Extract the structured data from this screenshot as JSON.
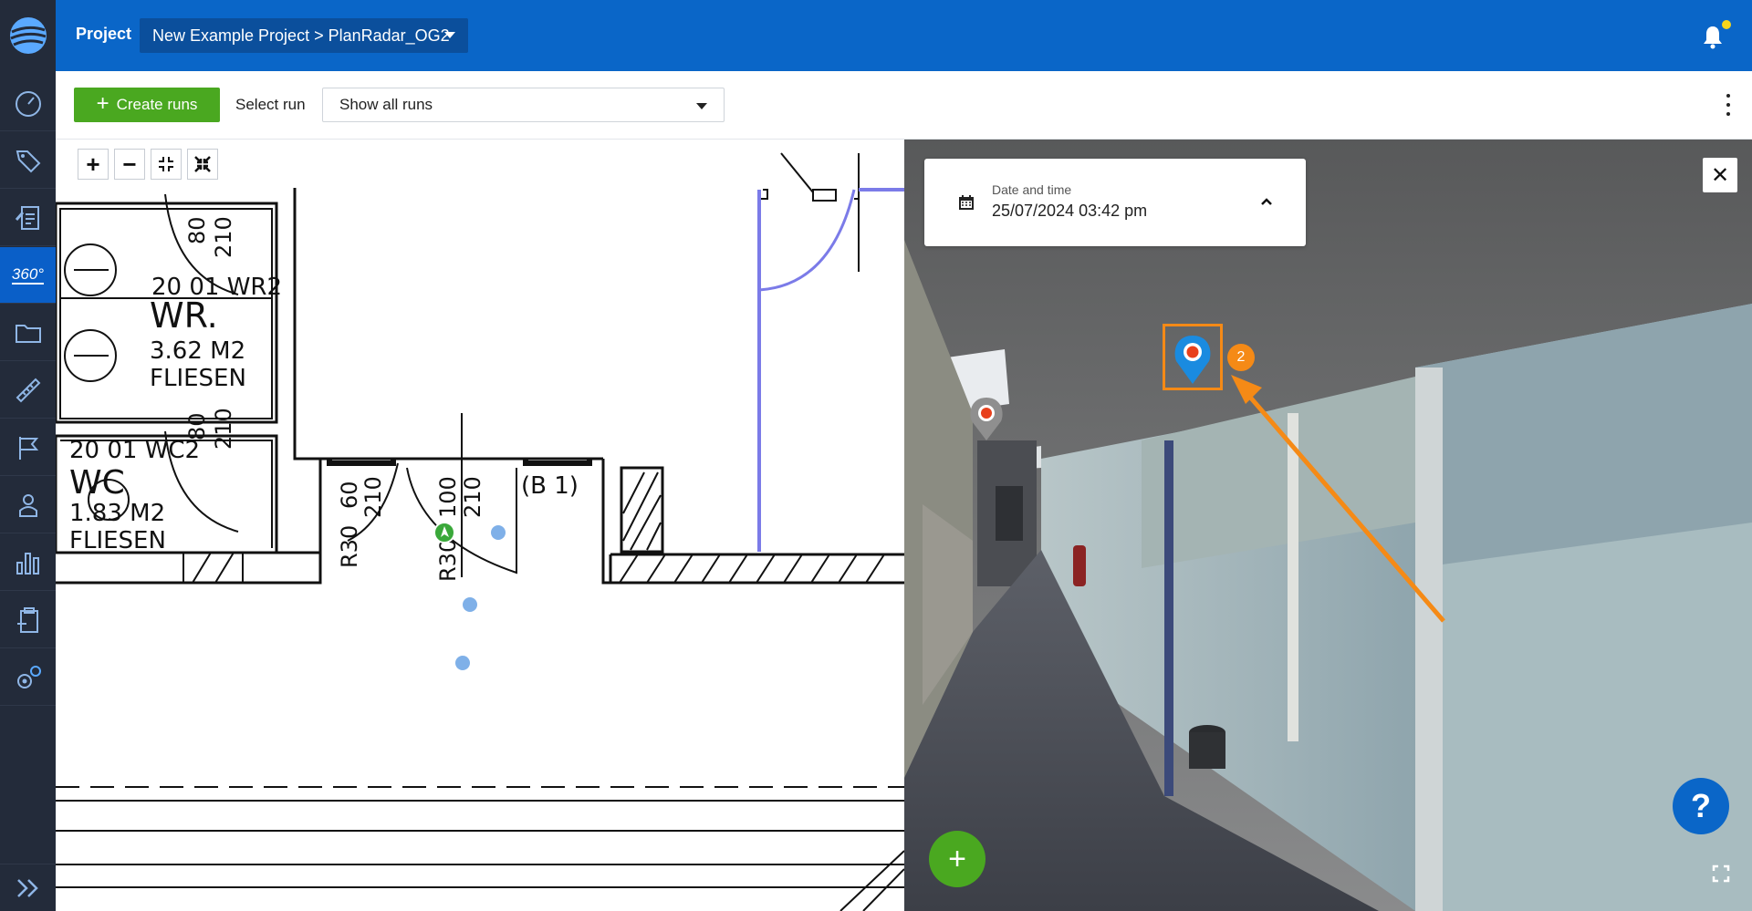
{
  "header": {
    "project_label": "Project",
    "project_path": "New Example Project > PlanRadar_OG2",
    "bell_dot_color": "#f7d51b"
  },
  "toolbar": {
    "create_label": "Create runs",
    "select_label": "Select run",
    "run_value": "Show all runs"
  },
  "sidebar": {
    "items": [
      {
        "name": "dashboard-icon"
      },
      {
        "name": "tag-icon"
      },
      {
        "name": "report-icon"
      },
      {
        "name": "360-icon",
        "label": "360°",
        "active": true
      },
      {
        "name": "folder-icon"
      },
      {
        "name": "ruler-icon"
      },
      {
        "name": "flag-icon"
      },
      {
        "name": "user-icon"
      },
      {
        "name": "statistics-icon"
      },
      {
        "name": "clipboard-icon"
      },
      {
        "name": "settings-icon"
      }
    ]
  },
  "plan": {
    "room_labels": {
      "wr_code": "20 01 WR2",
      "wr_name": "WR.",
      "wr_area": "3.62 M2",
      "wr_floor": "FLIESEN",
      "wc_code": "20 01 WC2",
      "wc_name": "WC",
      "wc_area": "1.83 M2",
      "wc_floor": "FLIESEN",
      "door_80a": "80",
      "door_210a": "210",
      "door_80b": "80",
      "door_210b": "210",
      "door_60": "60",
      "door_210c": "210",
      "door_100": "100",
      "door_210d": "210",
      "b1": "(B 1)",
      "r30a": "R30",
      "r30b": "R30"
    }
  },
  "pano": {
    "date_label": "Date and time",
    "date_value": "25/07/2024 03:42 pm",
    "badge_count": "2",
    "help": "?",
    "add": "+",
    "close": "✕"
  },
  "colors": {
    "brand_blue": "#0a66c8",
    "green": "#4aa820",
    "highlight_orange": "#f58a16",
    "sidebar_bg": "#232b3a"
  }
}
